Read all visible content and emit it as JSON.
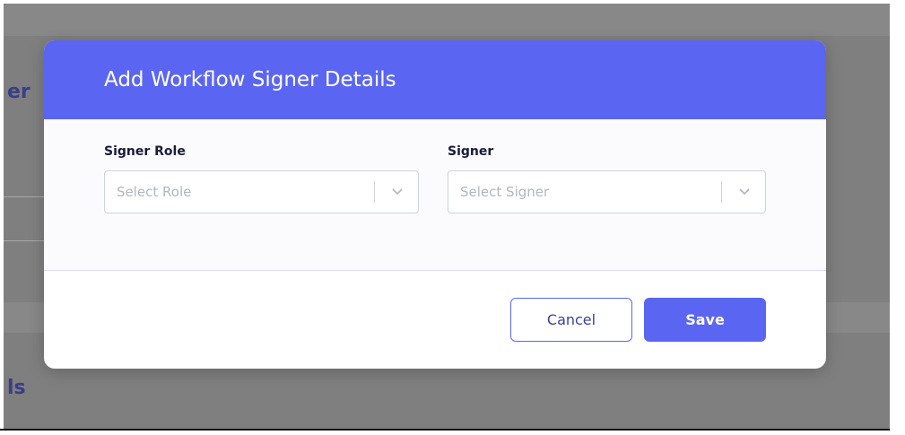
{
  "background": {
    "heading_fragment_top": "er",
    "heading_fragment_bottom": "ls"
  },
  "modal": {
    "title": "Add Workflow Signer Details",
    "fields": [
      {
        "label": "Signer Role",
        "placeholder": "Select Role",
        "icon": "chevron-down-icon"
      },
      {
        "label": "Signer",
        "placeholder": "Select Signer",
        "icon": "chevron-down-icon"
      }
    ],
    "buttons": {
      "cancel_label": "Cancel",
      "save_label": "Save"
    }
  },
  "colors": {
    "accent": "#5a66f2",
    "overlay": "#7f7f7f"
  }
}
